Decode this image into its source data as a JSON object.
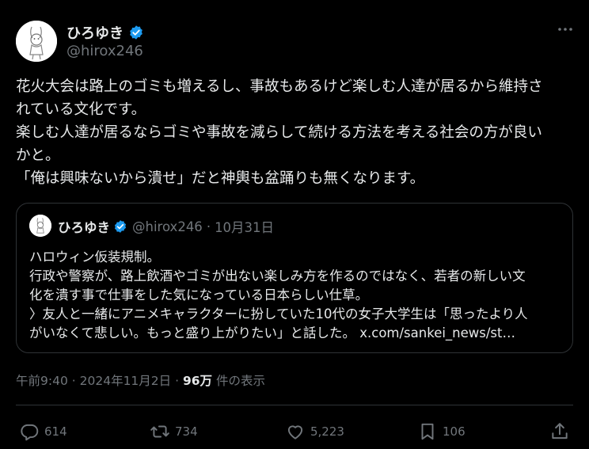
{
  "author": {
    "display_name": "ひろゆき",
    "handle": "@hirox246",
    "verified_icon": "verified-badge-icon"
  },
  "tweet": {
    "lines": [
      "花火大会は路上のゴミも増えるし、事故もあるけど楽しむ人達が居るから維持さ",
      "れている文化です。",
      "楽しむ人達が居るならゴミや事故を減らして続ける方法を考える社会の方が良い",
      "かと。",
      "「俺は興味ないから潰せ」だと神輿も盆踊りも無くなります。"
    ]
  },
  "quote": {
    "display_name": "ひろゆき",
    "handle": "@hirox246",
    "separator": "·",
    "date": "10月31日",
    "lines": [
      "ハロウィン仮装規制。",
      "行政や警察が、路上飲酒やゴミが出ない楽しみ方を作るのではなく、若者の新しい文",
      "化を潰す事で仕事をした気になっている日本らしい仕草。",
      "〉友人と一緒にアニメキャラクターに扮していた10代の女子大学生は「思ったより人",
      "がいなくて悲しい。もっと盛り上がりたい」と話した。 x.com/sankei_news/st…"
    ]
  },
  "meta": {
    "time": "午前9:40",
    "separator": "·",
    "date": "2024年11月2日",
    "separator2": "·",
    "views": "96万",
    "views_label": "件の表示"
  },
  "actions": {
    "reply_count": "614",
    "retweet_count": "734",
    "like_count": "5,223",
    "bookmark_count": "106"
  },
  "colors": {
    "background": "#000000",
    "text": "#e7e9ea",
    "secondary": "#71767b",
    "border": "#2f3336",
    "verified": "#1d9bf0"
  }
}
